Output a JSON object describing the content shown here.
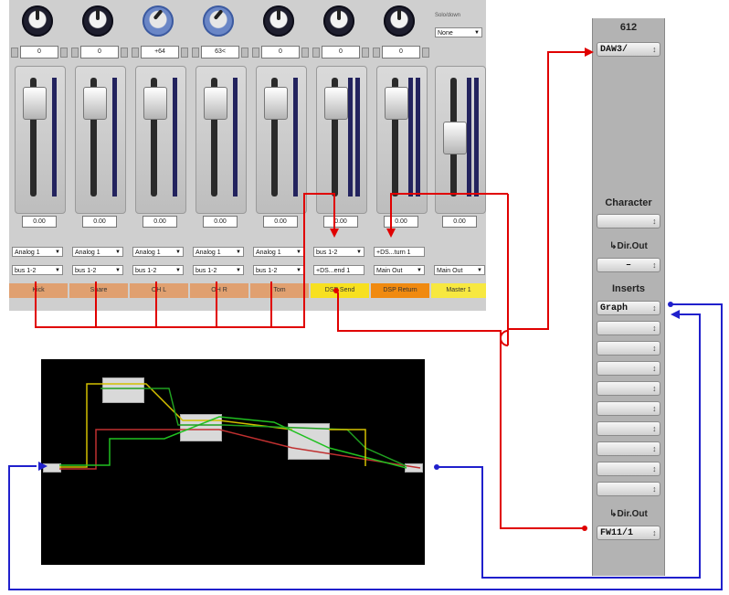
{
  "mixer": {
    "channels": [
      {
        "knob": "0",
        "db": "0.00",
        "in": "Analog 1",
        "bus": "bus 1-2",
        "name": "Kick",
        "color": "#e0a070",
        "knob_style": "dark"
      },
      {
        "knob": "0",
        "db": "0.00",
        "in": "Analog 1",
        "bus": "bus 1-2",
        "name": "Snare",
        "color": "#e0a070",
        "knob_style": "dark"
      },
      {
        "knob": "+64",
        "db": "0.00",
        "in": "Analog 1",
        "bus": "bus 1-2",
        "name": "OH L",
        "color": "#e0a070",
        "knob_style": "blue"
      },
      {
        "knob": "63<",
        "db": "0.00",
        "in": "Analog 1",
        "bus": "bus 1-2",
        "name": "OH R",
        "color": "#e0a070",
        "knob_style": "blue"
      },
      {
        "knob": "0",
        "db": "0.00",
        "in": "Analog 1",
        "bus": "bus 1-2",
        "name": "Tom",
        "color": "#e0a070",
        "knob_style": "dark"
      },
      {
        "knob": "0",
        "db": "0.00",
        "in": "bus 1-2",
        "bus": "+DS...end 1",
        "name": "DSP Send",
        "color": "#f7e020",
        "knob_style": "dark"
      },
      {
        "knob": "0",
        "db": "0.00",
        "in": "+DS...turn 1",
        "bus": "Main Out",
        "name": "DSP Return",
        "color": "#f08a10",
        "knob_style": "dark"
      },
      {
        "knob": "",
        "db": "0.00",
        "in": "",
        "bus": "Main Out",
        "name": "Master 1",
        "color": "#f7e840",
        "knob_style": "none"
      }
    ],
    "master_header": "Solo/down",
    "master_select": "None"
  },
  "panel": {
    "title": "612",
    "top_select": "DAW3/",
    "character_label": "Character",
    "character_value": "",
    "dir_out_label_1": "↳Dir.Out",
    "dir_out_value_1": "–",
    "inserts_label": "Inserts",
    "insert_first": "Graph",
    "insert_slots": [
      "",
      "",
      "",
      "",
      "",
      "",
      "",
      "",
      "",
      "",
      ""
    ],
    "dir_out_label_2": "↳Dir.Out",
    "dir_out_value_2": "FW11/1"
  },
  "graph": {
    "nodes": [
      "",
      "",
      ""
    ]
  },
  "colors": {
    "red_wire": "#e00000",
    "blue_wire": "#2020cc",
    "graph_bg": "#000000",
    "panel_bg": "#b3b3b3"
  }
}
